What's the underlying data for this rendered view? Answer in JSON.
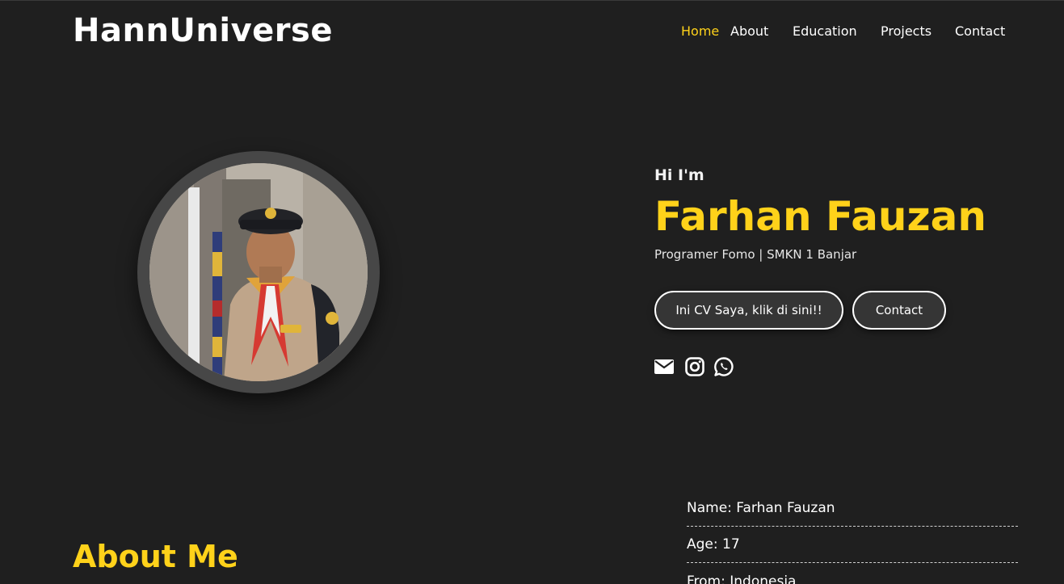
{
  "header": {
    "brand": "HannUniverse",
    "nav": [
      "Home",
      "About",
      "Education",
      "Projects",
      "Contact"
    ],
    "active_nav": "Home"
  },
  "hero": {
    "greeting": "Hi I'm",
    "name": "Farhan Fauzan",
    "role": "Programer Fomo | SMKN 1 Banjar",
    "buttons": {
      "cv": "Ini CV Saya, klik di sini!!",
      "contact": "Contact"
    },
    "social_icons": [
      "envelope-icon",
      "instagram-icon",
      "whatsapp-icon"
    ]
  },
  "about": {
    "title": "About Me",
    "info": [
      "Name: Farhan Fauzan",
      "Age: 17",
      "From: Indonesia"
    ]
  },
  "colors": {
    "background": "#1f1f1f",
    "accent": "#ffd21a",
    "text": "#ffffff"
  }
}
